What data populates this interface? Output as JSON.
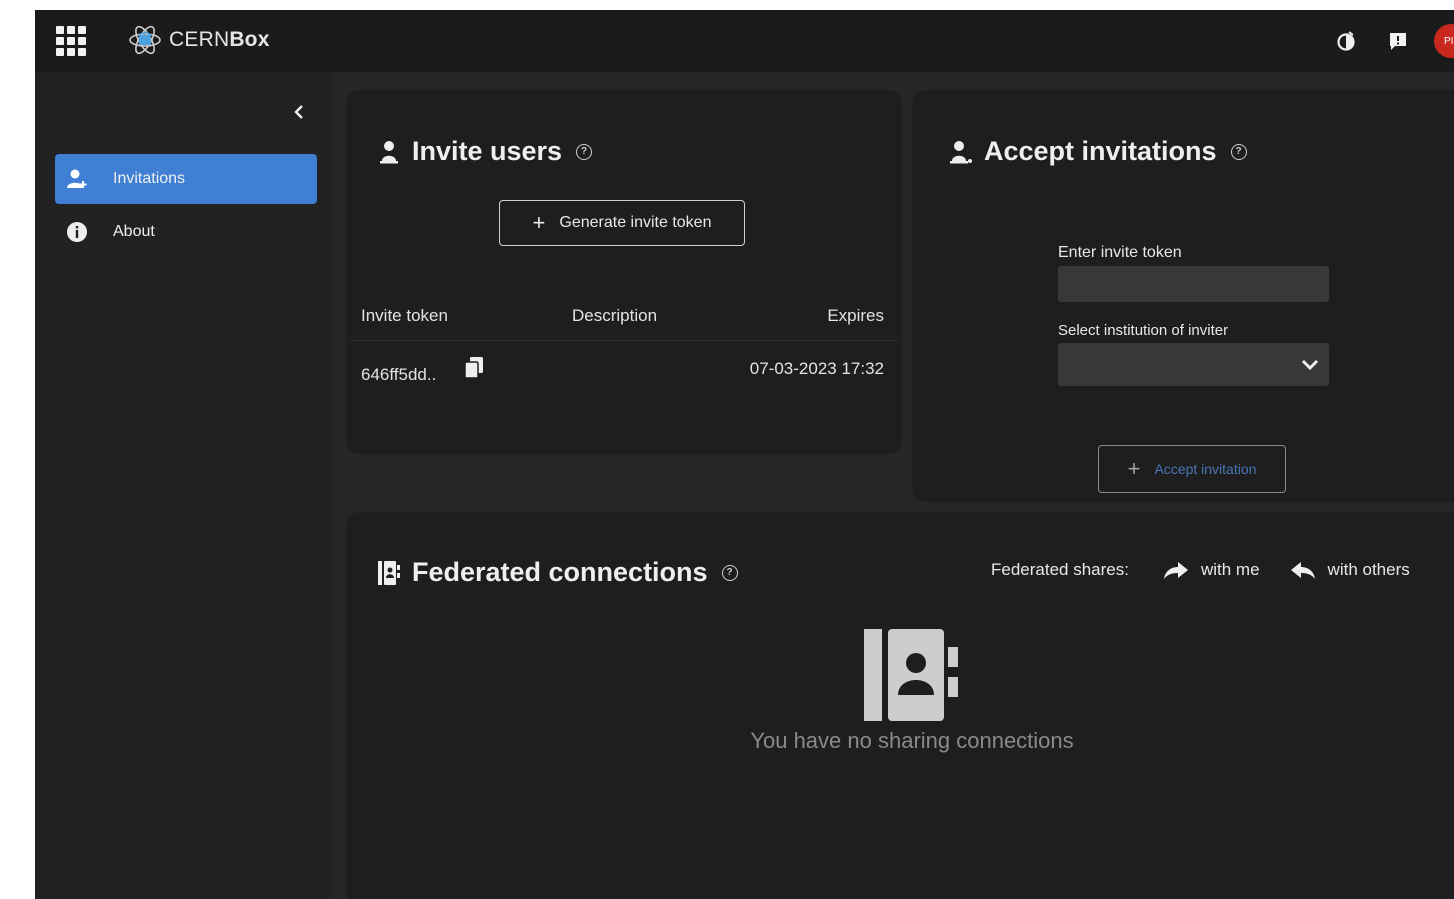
{
  "header": {
    "logo_light": "CERN",
    "logo_bold": "Box",
    "avatar_initials": "PI"
  },
  "sidebar": {
    "items": [
      {
        "label": "Invitations",
        "active": true
      },
      {
        "label": "About",
        "active": false
      }
    ]
  },
  "invite_users": {
    "title": "Invite users",
    "generate_button": "Generate invite token",
    "table": {
      "headers": [
        "Invite token",
        "Description",
        "Expires"
      ],
      "rows": [
        {
          "token": "646ff5dd..",
          "description": "",
          "expires": "07-03-2023 17:32"
        }
      ]
    }
  },
  "accept_invitations": {
    "title": "Accept invitations",
    "token_label": "Enter invite token",
    "token_value": "",
    "institution_label": "Select institution of inviter",
    "institution_value": "",
    "accept_button": "Accept invitation"
  },
  "federated": {
    "title": "Federated connections",
    "shares_label": "Federated shares:",
    "with_me": "with me",
    "with_others": "with others",
    "empty_text": "You have no sharing connections"
  },
  "colors": {
    "accent": "#3f80d4",
    "background": "#1b1b1b",
    "card": "#1e1e1e",
    "avatar": "#c9281e"
  }
}
